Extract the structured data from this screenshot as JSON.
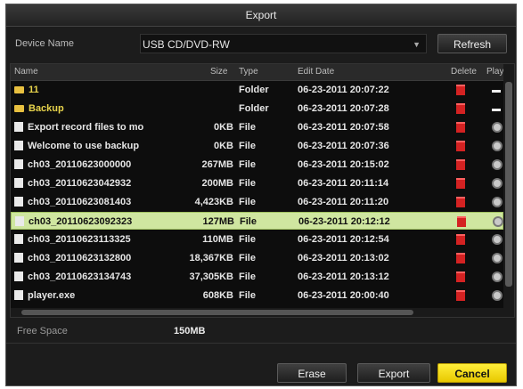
{
  "window": {
    "title": "Export"
  },
  "device": {
    "label": "Device Name",
    "value": "USB CD/DVD-RW"
  },
  "buttons": {
    "refresh": "Refresh",
    "erase": "Erase",
    "export": "Export",
    "cancel": "Cancel"
  },
  "table": {
    "headers": {
      "name": "Name",
      "size": "Size",
      "type": "Type",
      "date": "Edit Date",
      "delete": "Delete",
      "play": "Play"
    },
    "rows": [
      {
        "name": "11",
        "size": "",
        "type": "Folder",
        "date": "06-23-2011 20:07:22",
        "kind": "folder"
      },
      {
        "name": "Backup",
        "size": "",
        "type": "Folder",
        "date": "06-23-2011 20:07:28",
        "kind": "folder"
      },
      {
        "name": "Export record files to mo",
        "size": "0KB",
        "type": "File",
        "date": "06-23-2011 20:07:58",
        "kind": "file"
      },
      {
        "name": "Welcome to use backup",
        "size": "0KB",
        "type": "File",
        "date": "06-23-2011 20:07:36",
        "kind": "file"
      },
      {
        "name": "ch03_20110623000000",
        "size": "267MB",
        "type": "File",
        "date": "06-23-2011 20:15:02",
        "kind": "file"
      },
      {
        "name": "ch03_20110623042932",
        "size": "200MB",
        "type": "File",
        "date": "06-23-2011 20:11:14",
        "kind": "file"
      },
      {
        "name": "ch03_20110623081403",
        "size": "4,423KB",
        "type": "File",
        "date": "06-23-2011 20:11:20",
        "kind": "file"
      },
      {
        "name": "ch03_20110623092323",
        "size": "127MB",
        "type": "File",
        "date": "06-23-2011 20:12:12",
        "kind": "file",
        "selected": true
      },
      {
        "name": "ch03_20110623113325",
        "size": "110MB",
        "type": "File",
        "date": "06-23-2011 20:12:54",
        "kind": "file"
      },
      {
        "name": "ch03_20110623132800",
        "size": "18,367KB",
        "type": "File",
        "date": "06-23-2011 20:13:02",
        "kind": "file"
      },
      {
        "name": "ch03_20110623134743",
        "size": "37,305KB",
        "type": "File",
        "date": "06-23-2011 20:13:12",
        "kind": "file"
      },
      {
        "name": "player.exe",
        "size": "608KB",
        "type": "File",
        "date": "06-23-2011 20:00:40",
        "kind": "file"
      }
    ]
  },
  "free_space": {
    "label": "Free Space",
    "value": "150MB"
  },
  "colors": {
    "accent": "#f2dc10",
    "selected_row": "#cfe6a0",
    "folder": "#e8c040",
    "delete": "#d42222"
  }
}
